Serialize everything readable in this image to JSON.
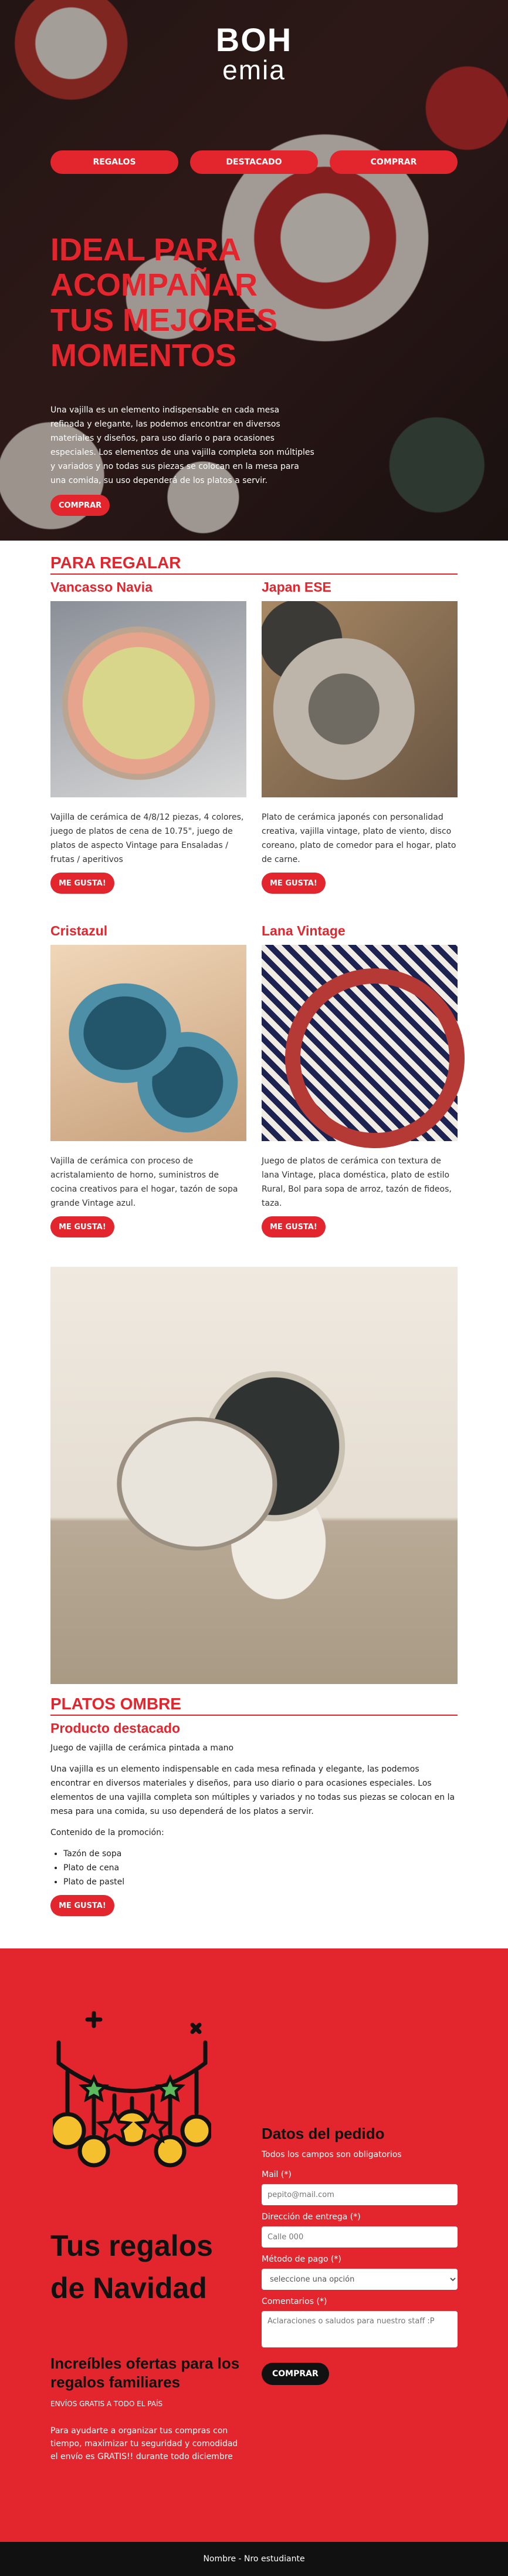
{
  "hero": {
    "logo_line1": "BOH",
    "logo_line2": "emia",
    "nav": [
      "REGALOS",
      "DESTACADO",
      "COMPRAR"
    ],
    "title": "IDEAL PARA ACOMPAÑAR TUS MEJORES MOMENTOS",
    "text": "Una vajilla es un elemento indispensable en cada mesa refinada y elegante, las podemos encontrar en diversos materiales y diseños, para uso diario o para ocasiones especiales. Los elementos de una vajilla completa son múltiples y variados y no todas sus piezas se colocan en la mesa para una comida, su uso dependerá de los platos a servir.",
    "button": "COMPRAR"
  },
  "gifts": {
    "title": "PARA REGALAR",
    "items": [
      {
        "name": "Vancasso Navia",
        "desc": "Vajilla de cerámica de 4/8/12 piezas, 4 colores, juego de platos de cena de 10.75\", juego de platos de aspecto Vintage para Ensaladas / frutas / aperitivos",
        "button": "ME GUSTA!"
      },
      {
        "name": "Japan ESE",
        "desc": "Plato de cerámica japonés con personalidad creativa, vajilla vintage, plato de viento, disco coreano, plato de comedor para el hogar, plato de carne.",
        "button": "ME GUSTA!"
      },
      {
        "name": "Cristazul",
        "desc": "Vajilla de cerámica con proceso de acristalamiento de horno, suministros de cocina creativos para el hogar, tazón de sopa grande Vintage azul.",
        "button": "ME GUSTA!"
      },
      {
        "name": "Lana Vintage",
        "desc": "Juego de platos de cerámica con textura de lana Vintage, placa doméstica, plato de estilo Rural, Bol para sopa de arroz, tazón de fideos, taza.",
        "button": "ME GUSTA!"
      }
    ]
  },
  "featured": {
    "title": "PLATOS OMBRE",
    "subtitle": "Producto destacado",
    "short": "Juego de vajilla de cerámica pintada a mano",
    "text": "Una vajilla es un elemento indispensable en cada mesa refinada y elegante, las podemos encontrar en diversos materiales y diseños, para uso diario o para ocasiones especiales. Los elementos de una vajilla completa son múltiples y variados y no todas sus piezas se colocan en la mesa para una comida, su uso dependerá de los platos a servir.",
    "contents_label": "Contenido de la promoción:",
    "contents": [
      "Tazón de sopa",
      "Plato de cena",
      "Plato de pastel"
    ],
    "button": "ME GUSTA!"
  },
  "xmas": {
    "title": "Tus regalos de Navidad",
    "subtitle": "Increíbles ofertas para los regalos familiares",
    "shipping": "ENVÍOS GRATIS A TODO EL PAÍS",
    "text": "Para ayudarte a organizar tus compras con tiempo, maximizar tu seguridad y comodidad el envío es GRATIS!! durante todo diciembre"
  },
  "order_form": {
    "title": "Datos del pedido",
    "note": "Todos los campos son obligatorios",
    "mail_label": "Mail (*)",
    "mail_placeholder": "pepito@mail.com",
    "address_label": "Dirección de entrega (*)",
    "address_placeholder": "Calle 000",
    "payment_label": "Método de pago (*)",
    "payment_selected": "seleccione una opción",
    "comments_label": "Comentarios (*)",
    "comments_placeholder": "Aclaraciones o saludos para nuestro staff :P",
    "submit": "COMPRAR"
  },
  "footer": {
    "text": "Nombre - Nro estudiante"
  },
  "colors": {
    "accent": "#e3262d",
    "dark": "#111111"
  }
}
